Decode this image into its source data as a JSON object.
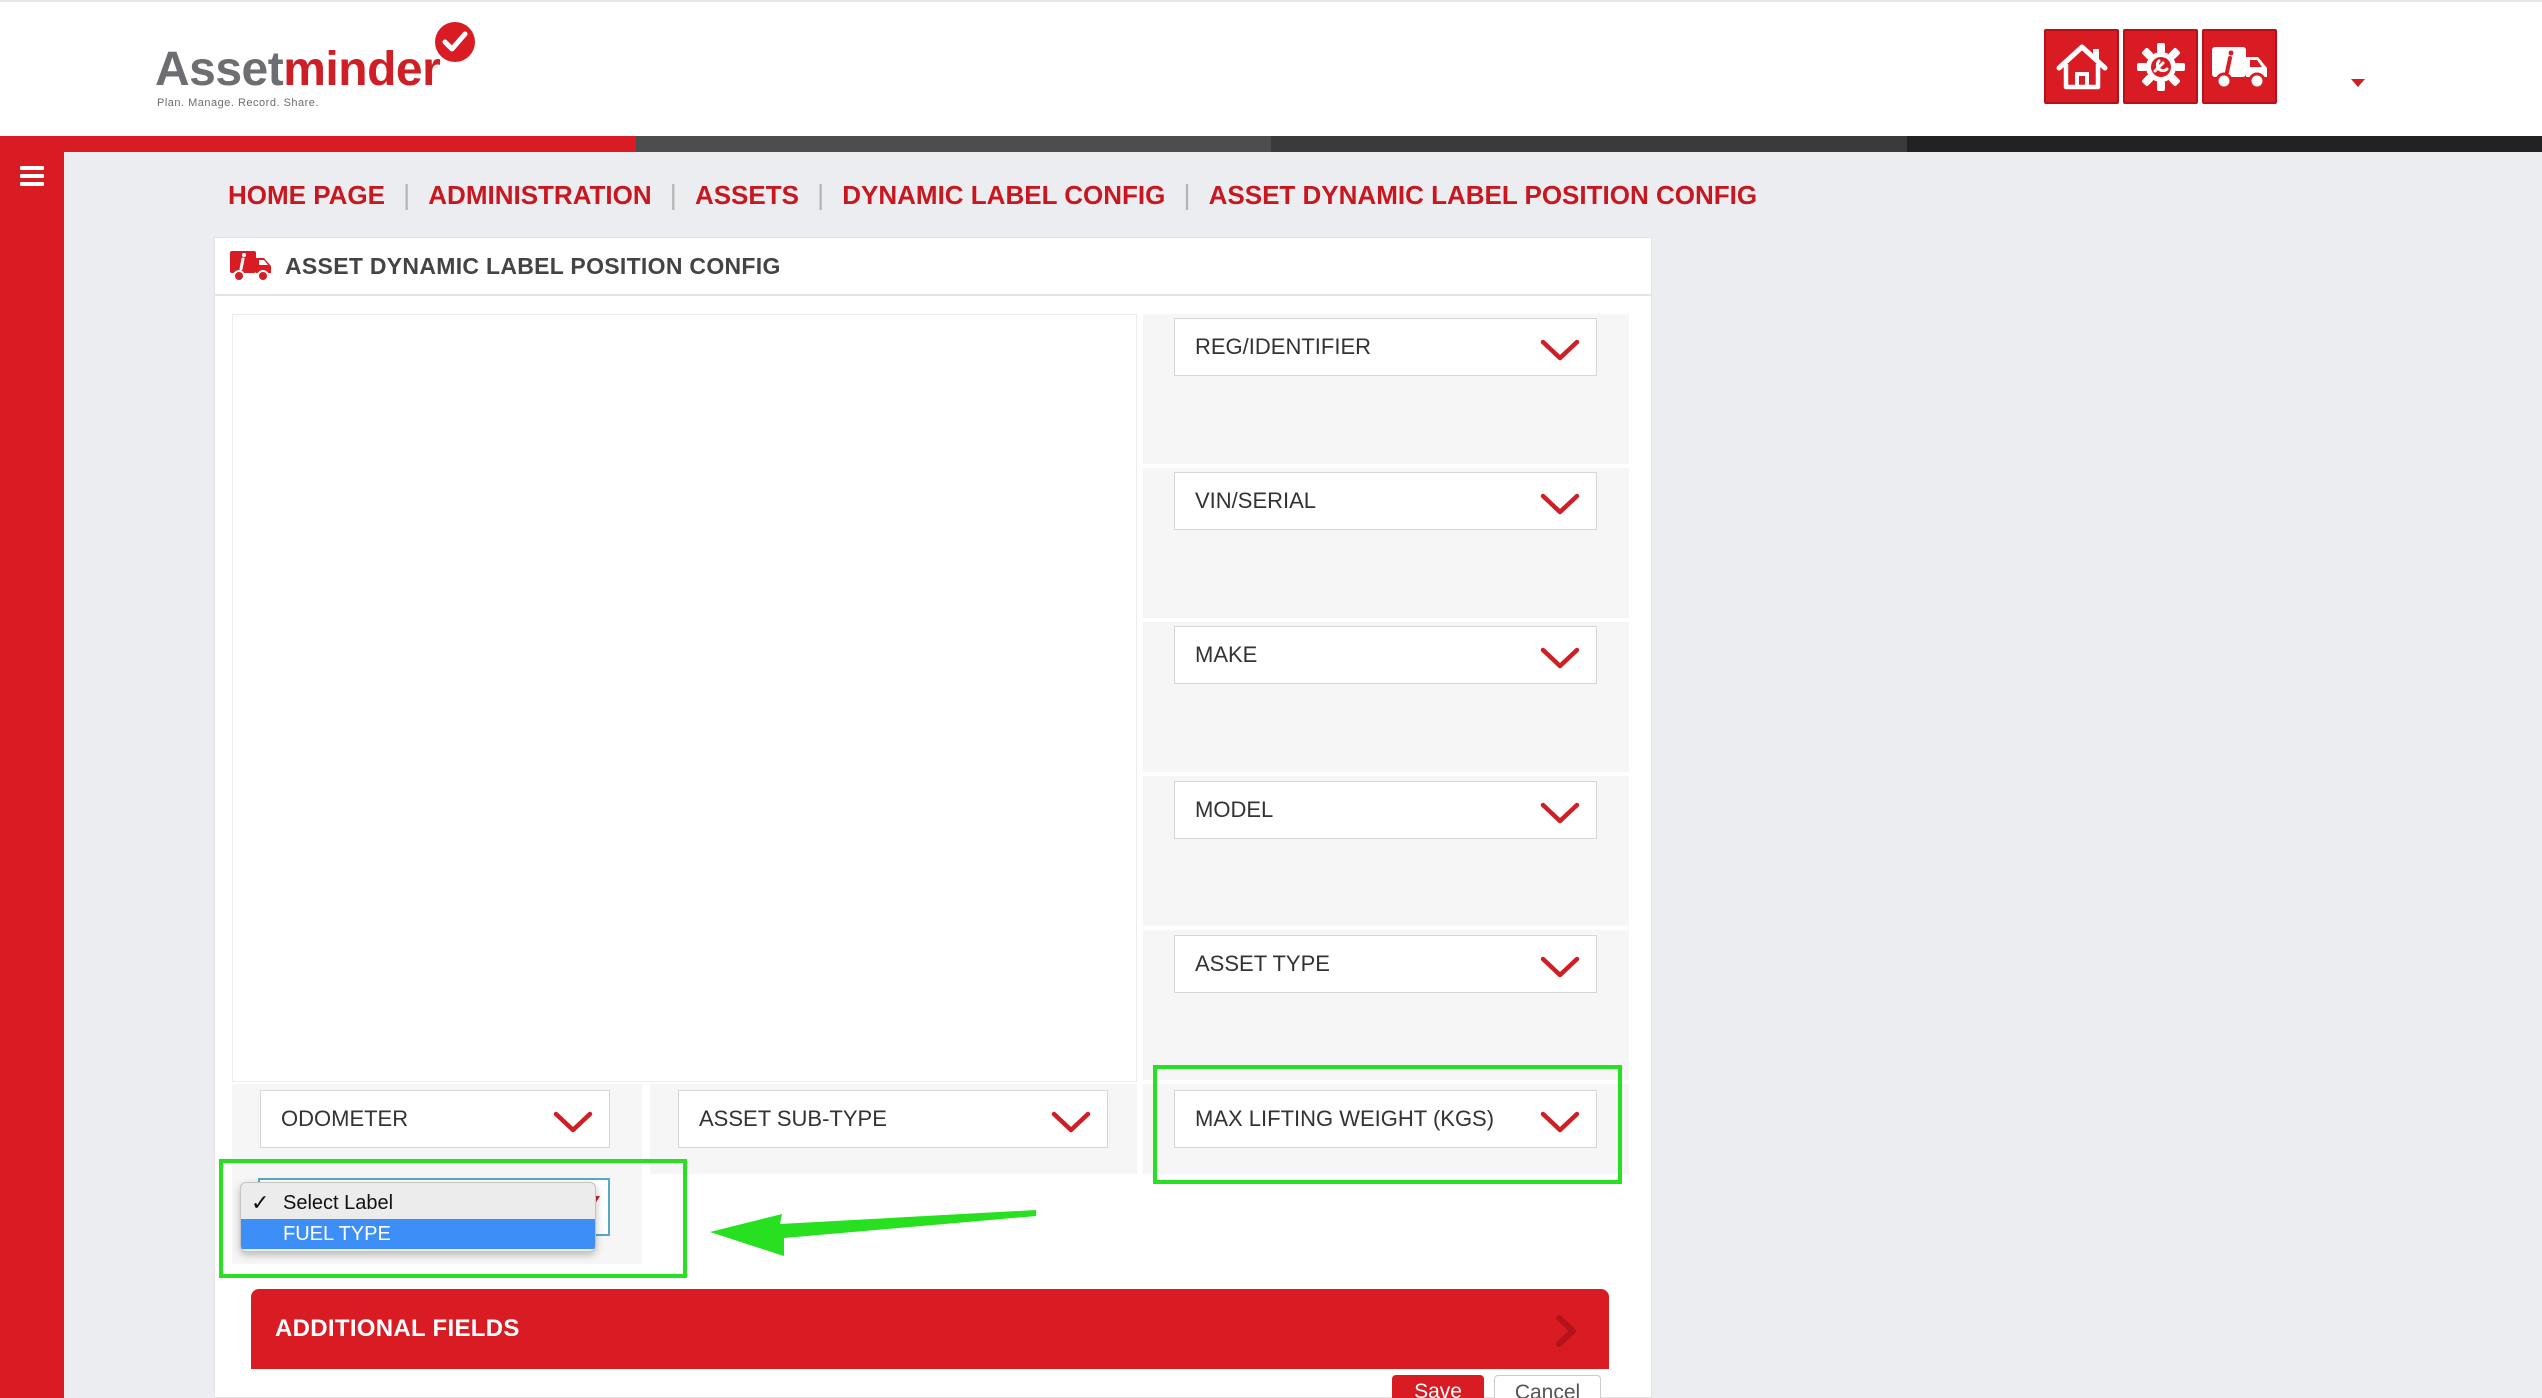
{
  "brand": {
    "name_part1": "Asset",
    "name_part2": "minder",
    "tagline": "Plan. Manage. Record. Share.",
    "primary_color": "#d91c24",
    "grey_color": "#6d6e71"
  },
  "header_buttons": [
    {
      "icon": "home-icon"
    },
    {
      "icon": "settings-gear-icon"
    },
    {
      "icon": "truck-info-icon"
    }
  ],
  "progress_colors": [
    "#d91c24",
    "#4d4d4f",
    "#3a3a3c",
    "#222224"
  ],
  "breadcrumb": {
    "items": [
      "HOME PAGE",
      "ADMINISTRATION",
      "ASSETS",
      "DYNAMIC LABEL CONFIG",
      "ASSET DYNAMIC LABEL POSITION CONFIG"
    ],
    "separator": "|"
  },
  "panel": {
    "title": "ASSET DYNAMIC LABEL POSITION CONFIG",
    "icon": "truck-info-icon"
  },
  "right_column": [
    "REG/IDENTIFIER",
    "VIN/SERIAL",
    "MAKE",
    "MODEL",
    "ASSET TYPE",
    "MAX LIFTING WEIGHT (KGS)"
  ],
  "bottom_row": [
    "ODOMETER",
    "ASSET SUB-TYPE"
  ],
  "dropdown": {
    "options": [
      "Select Label",
      "FUEL TYPE"
    ],
    "checked": "Select Label",
    "highlighted": "FUEL TYPE",
    "check_glyph": "✓"
  },
  "additional_fields": {
    "label": "ADDITIONAL FIELDS"
  },
  "actions": {
    "save_label": "Save",
    "cancel_label": "Cancel"
  },
  "annotation_color": "#27e020"
}
